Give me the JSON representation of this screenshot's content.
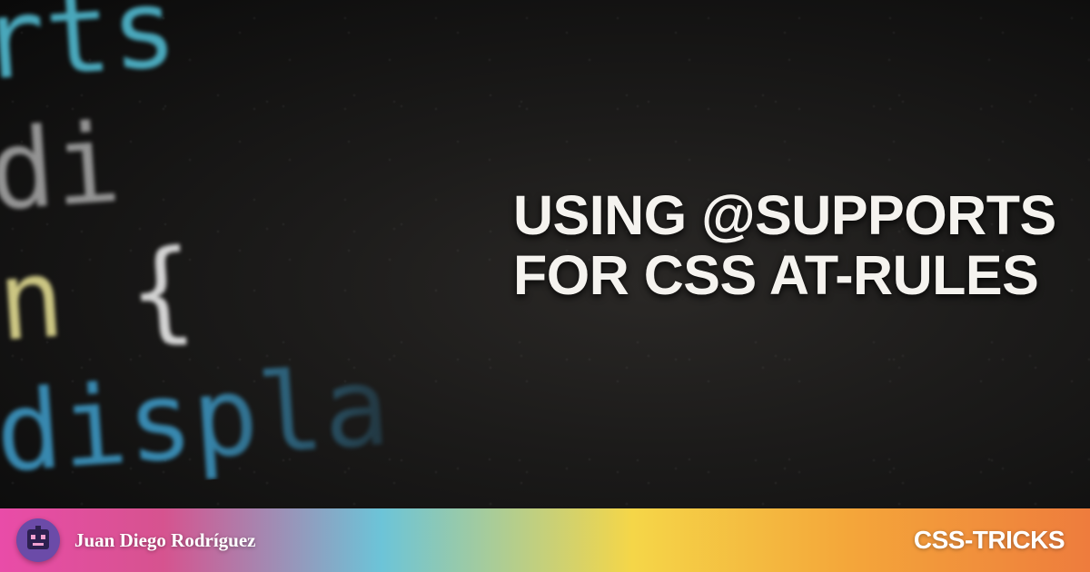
{
  "article": {
    "title_line1": "USING @SUPPORTS",
    "title_line2": "FOR CSS AT-RULES"
  },
  "code_snippet": {
    "line1_a": "orts",
    "line1_b": "(di",
    "line2_a": "in",
    "line2_b": "{",
    "line3": "displa"
  },
  "footer": {
    "author": "Juan Diego Rodríguez",
    "site": "CSS-TRICKS"
  }
}
